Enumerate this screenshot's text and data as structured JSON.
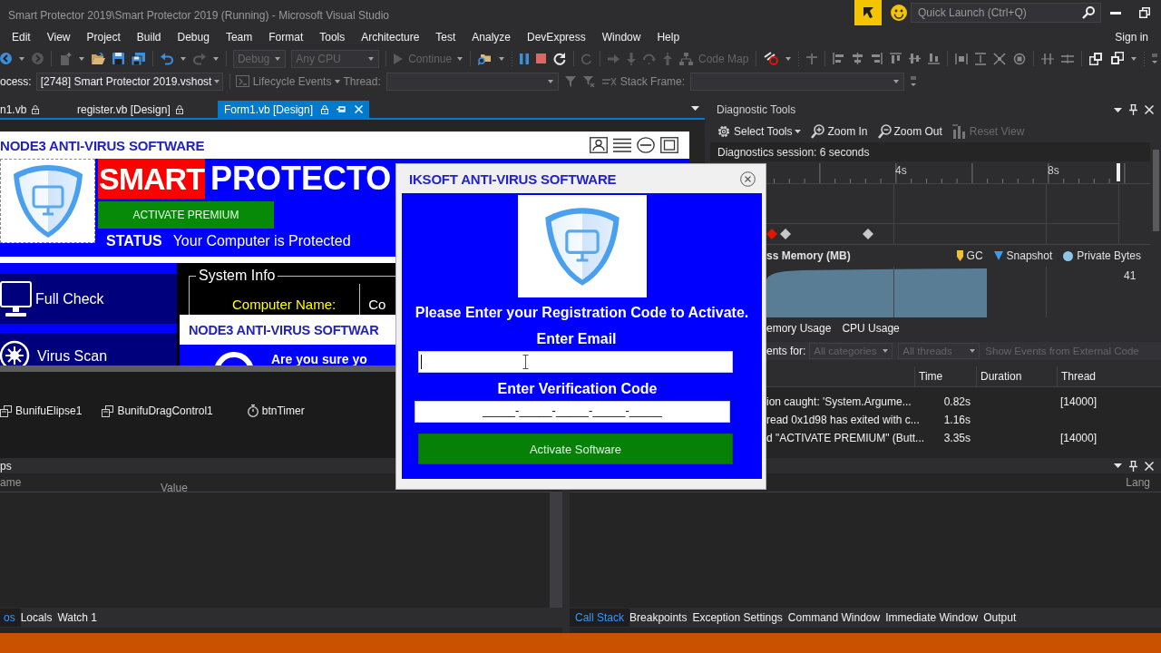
{
  "window": {
    "title": "Smart Protector 2019\\Smart Protector 2019 (Running) - Microsoft Visual Studio",
    "quick_launch": {
      "placeholder": "Quick Launch (Ctrl+Q)"
    }
  },
  "menu": {
    "items": [
      "Edit",
      "View",
      "Project",
      "Build",
      "Debug",
      "Team",
      "Format",
      "Tools",
      "Architecture",
      "Test",
      "Analyze",
      "DevExpress",
      "Window",
      "Help"
    ],
    "account": "Sign in"
  },
  "standard_toolbar": {
    "configuration": "Debug",
    "platform": "Any CPU",
    "continue": "Continue",
    "code_map": "Code Map"
  },
  "debug_location_toolbar": {
    "process_label": "ocess:",
    "process": "[2748] Smart Protector 2019.vshost",
    "lifecycle_events": "Lifecycle Events",
    "thread_label": "Thread:",
    "stack_frame_label": "Stack Frame:"
  },
  "document_tabs": [
    {
      "label": "n1.vb",
      "selected": false
    },
    {
      "label": "register.vb [Design]",
      "selected": false
    },
    {
      "label": "Form1.vb [Design]",
      "selected": true
    }
  ],
  "designer": {
    "form_title": "NODE3 ANTI-VIRUS SOFTWARE",
    "brand": {
      "highlight": "SMART",
      "rest": "PROTECTO"
    },
    "activate_button": "ACTIVATE PREMIUM",
    "status": {
      "label": "STATUS",
      "text": "Your Computer is Protected"
    },
    "nav_items": [
      {
        "kind": "monitor",
        "label": "Full Check"
      },
      {
        "kind": "virus",
        "label": "Virus Scan"
      }
    ],
    "system_info": {
      "title": "System Info",
      "label": "Computer Name:",
      "column_2": "Co"
    },
    "message_box": {
      "title": "NODE3 ANTI-VIRUS SOFTWAR",
      "message": "Are you sure yo"
    }
  },
  "component_tray": [
    {
      "kind": "component",
      "label": "BunifuElipse1"
    },
    {
      "kind": "component",
      "label": "BunifuDragControl1"
    },
    {
      "kind": "timer",
      "label": "btnTimer"
    }
  ],
  "diagnostic_tools": {
    "title": "Diagnostic Tools",
    "toolbar": [
      {
        "kind": "gear",
        "label": "Select Tools",
        "disabled": false
      },
      {
        "kind": "zoom_in",
        "label": "Zoom In",
        "disabled": false
      },
      {
        "kind": "zoom_out",
        "label": "Zoom Out",
        "disabled": false
      },
      {
        "kind": "reset",
        "label": "Reset View",
        "disabled": true
      }
    ],
    "session": "Diagnostics session: 6 seconds",
    "timeline_labels": [
      "4s",
      "8s"
    ],
    "memory_title": "ss Memory (MB)",
    "legend": [
      {
        "kind": "gc",
        "label": "GC"
      },
      {
        "kind": "snapshot",
        "label": "Snapshot"
      },
      {
        "kind": "private_bytes",
        "label": "Private Bytes"
      }
    ],
    "memory_scale": "41",
    "tabs": [
      {
        "label": "emory Usage",
        "selected": false
      },
      {
        "label": "CPU Usage",
        "selected": false
      }
    ],
    "filter": {
      "label": "ents for:",
      "categories": "All categories",
      "threads": "All threads",
      "external_code": "Show Events from External Code"
    },
    "events_table": {
      "columns": [
        "Time",
        "Duration",
        "Thread"
      ],
      "rows": [
        {
          "event": "ion caught: 'System.Argume...",
          "time": "0.82s",
          "thread": "[14000]"
        },
        {
          "event": "read 0x1d98 has exited with c...",
          "time": "1.16s"
        },
        {
          "event": "d \"ACTIVATE PREMIUM\" (Butt...",
          "time": "3.35s",
          "thread": "[14000]"
        }
      ]
    }
  },
  "locals": {
    "title": "ps",
    "columns": [
      "ame",
      "Value"
    ],
    "tabs": [
      {
        "label": "os",
        "selected": true
      },
      {
        "label": "Locals",
        "selected": false
      },
      {
        "label": "Watch 1",
        "selected": false
      }
    ]
  },
  "call_stack": {
    "columns": [
      "Lang"
    ],
    "tabs": [
      {
        "label": "Call Stack",
        "selected": true
      },
      {
        "label": "Breakpoints",
        "selected": false
      },
      {
        "label": "Exception Settings",
        "selected": false
      },
      {
        "label": "Command Window",
        "selected": false
      },
      {
        "label": "Immediate Window",
        "selected": false
      },
      {
        "label": "Output",
        "selected": false
      }
    ]
  },
  "registration_dialog": {
    "title": "IKSOFT ANTI-VIRUS SOFTWARE",
    "prompt": "Please Enter your Registration Code to Activate.",
    "email_label": "Enter Email",
    "email_field": {
      "focused": true
    },
    "code_label": "Enter Verification Code",
    "code_field": {
      "value": "_____-_____-_____-_____-_____"
    },
    "submit": "Activate Software"
  }
}
